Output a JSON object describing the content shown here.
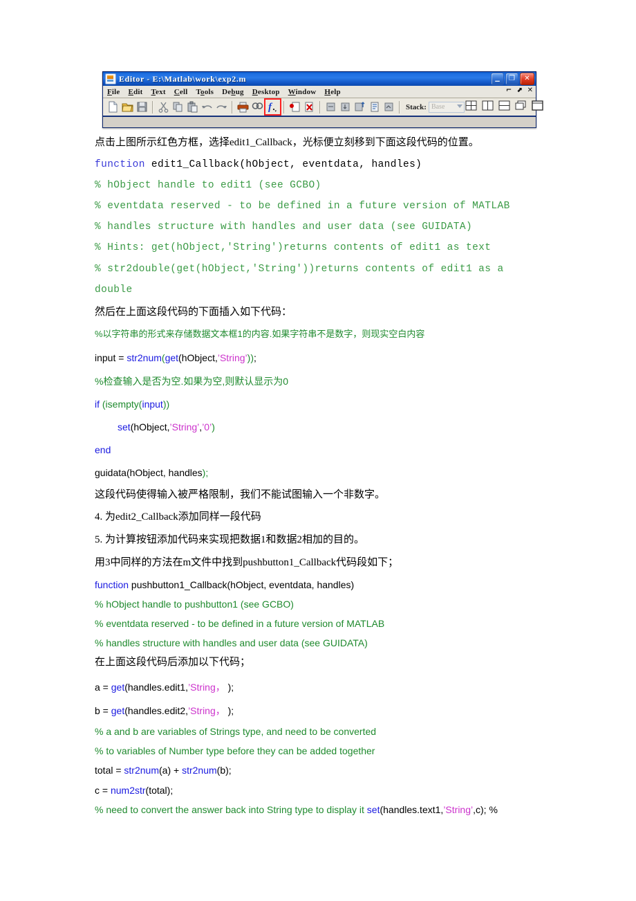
{
  "window": {
    "title": "Editor - E:\\Matlab\\work\\exp2.m",
    "icon": "matlab-editor-icon",
    "buttons": {
      "minimize": "_",
      "maximize": "❐",
      "close": "✕"
    },
    "menu": [
      "File",
      "Edit",
      "Text",
      "Cell",
      "Tools",
      "Debug",
      "Desktop",
      "Window",
      "Help"
    ],
    "menu_right": [
      "↰",
      "⬈",
      "✕"
    ],
    "toolbar": {
      "icons_left": [
        "new-file-icon",
        "open-folder-icon",
        "save-icon",
        "cut-icon",
        "copy-icon",
        "paste-icon",
        "undo-icon",
        "redo-icon",
        "print-icon",
        "find-icon",
        "function-list-icon",
        "set-breakpoint-icon",
        "clear-breakpoints-icon",
        "step-icon",
        "step-in-icon",
        "step-out-icon",
        "continue-icon",
        "exit-debug-icon"
      ],
      "stack_label": "Stack:",
      "stack_value": "Base",
      "icons_right": [
        "tile-grid-icon",
        "tile-columns-icon",
        "tile-rows-icon",
        "float-icon",
        "dock-icon"
      ],
      "highlighted_icon": "function-list-icon",
      "highlight_color": "#ff2020"
    }
  },
  "body": {
    "line_click_redbox": "点击上图所示红色方框，选择edit1_Callback，光标便立刻移到下面这段代码的位置。",
    "code1": {
      "l1_kw": "function",
      "l1_rest": " edit1_Callback(hObject, eventdata, handles)",
      "l2": "% hObject handle to edit1 (see GCBO)",
      "l3": "% eventdata reserved - to be defined in a future version of MATLAB",
      "l4": "% handles structure with handles and user data (see GUIDATA)",
      "l5": "% Hints: get(hObject,'String')returns contents of edit1 as text",
      "l6": "% str2double(get(hObject,'String'))returns contents of edit1 as a",
      "l7": "double"
    },
    "line_insert_below": "然后在上面这段代码的下面插入如下代码：",
    "code2": {
      "c_comment1": "%以字符串的形式来存储数据文本框1的内容.如果字符串不是数字，则现实空白内容",
      "input_line_a": "input = ",
      "input_line_b": "str2num",
      "input_line_c": "(",
      "input_line_d": "get",
      "input_line_e": "(hObject,",
      "input_line_f": "’String’",
      "input_line_g": "))",
      "input_line_h": ";",
      "c_comment2": "%检查输入是否为空.如果为空,则默认显示为0",
      "if_kw": "if",
      "if_open": " (isempty(",
      "if_input": "input",
      "if_close": "))",
      "set_kw": "set",
      "set_a": "(hObject,",
      "set_str1": "’String’",
      "set_comma": ",",
      "set_str2": "’0’",
      "set_close": ")",
      "end_kw": "end",
      "guidata_a": "guidata",
      "guidata_b": "(hObject, handles",
      "guidata_c": ");"
    },
    "line_strict": "这段代码使得输入被严格限制，我们不能试图输入一个非数字。",
    "step4": "4.  为edit2_Callback添加同样一段代码",
    "step5": "5.  为计算按钮添加代码来实现把数据1和数据2相加的目的。",
    "line_find_pushbutton": "用3中同样的方法在m文件中找到pushbutton1_Callback代码段如下；",
    "code3": {
      "l1_kw": "function",
      "l1_rest": " pushbutton1_Callback(hObject, eventdata, handles)",
      "l2": "% hObject handle to pushbutton1 (see GCBO)",
      "l3": "% eventdata reserved - to be defined in a future version of MATLAB",
      "l4": "% handles structure with handles and user data (see GUIDATA)"
    },
    "line_add_after": "在上面这段代码后添加以下代码；",
    "code4": {
      "a_prefix": "a = ",
      "a_get": "get",
      "a_mid": "(handles.edit1,",
      "a_str": "’String，",
      "a_suffix": " );",
      "b_prefix": "b = ",
      "b_get": "get",
      "b_mid": "(handles.edit2,",
      "b_str": "’String，",
      "b_suffix": " );",
      "cmt1": "% a and b are variables of Strings type, and need to be converted",
      "cmt2": "% to variables of Number type before they can be added together",
      "total_prefix": "total = ",
      "total_f1": "str2num",
      "total_mid": "(a) + ",
      "total_f2": "str2num",
      "total_suffix": "(b);",
      "c_prefix": "c = ",
      "c_f": "num2str",
      "c_suffix": "(total);",
      "last_cmt": "% need to convert the answer back into String type to display it ",
      "last_set": "set",
      "last_a": "(handles.text1,",
      "last_str": "’String’",
      "last_b": ",c); %"
    }
  },
  "colors": {
    "keyword": "#3a3ad8",
    "comment": "#3a9a45",
    "string": "#cc33cc",
    "text": "#000000",
    "titlebar": "#1d6ee0",
    "highlight_box": "#ff2020"
  }
}
